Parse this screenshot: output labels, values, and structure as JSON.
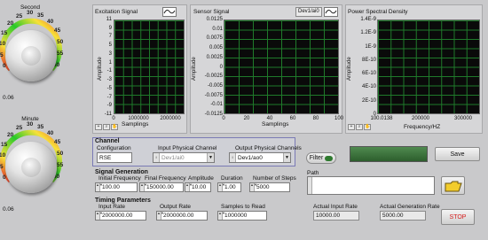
{
  "knobs": {
    "second": {
      "title": "Second",
      "scale": [
        "0",
        "5",
        "10",
        "15",
        "20",
        "25",
        "30",
        "35",
        "40",
        "45",
        "50",
        "55",
        "60"
      ],
      "value_readout": "0.06"
    },
    "minute": {
      "title": "Minute",
      "scale": [
        "0",
        "5",
        "10",
        "15",
        "20",
        "25",
        "30",
        "35",
        "40",
        "45",
        "50",
        "55",
        "60"
      ],
      "value_readout": "0.06"
    }
  },
  "excitation": {
    "title": "Excitation Signal",
    "ylabel": "Amplitude",
    "xlabel": "Samplings",
    "yticks": [
      "11",
      "9",
      "7",
      "5",
      "3",
      "1",
      "-1",
      "-3",
      "-5",
      "-7",
      "-9",
      "-11"
    ],
    "xticks": [
      "0",
      "1000000",
      "2000000"
    ]
  },
  "sensor": {
    "title": "Sensor Signal",
    "channel": "Dev1/ai0",
    "ylabel": "Amplitude",
    "xlabel": "Samplings",
    "yticks": [
      "0.0125",
      "0.01",
      "0.0075",
      "0.005",
      "0.0025",
      "0",
      "-0.0025",
      "-0.005",
      "-0.0075",
      "-0.01",
      "-0.0125"
    ],
    "xticks": [
      "0",
      "20",
      "40",
      "60",
      "80",
      "100"
    ]
  },
  "psd": {
    "title": "Power Spectral Density",
    "ylabel": "Amplitude",
    "xlabel": "Frequency/HZ",
    "yticks": [
      "1.4E-9",
      "1.2E-9",
      "1E-9",
      "8E-10",
      "6E-10",
      "4E-10",
      "2E-10",
      "0"
    ],
    "xticks": [
      "100.0138",
      "200000",
      "300000"
    ]
  },
  "channel": {
    "header": "Channel",
    "config_label": "Configuration",
    "config_value": "RSE",
    "input_label": "Input Physical Channel",
    "input_value": "Dev1/ai0",
    "output_label": "Output Physical Channels",
    "output_value": "Dev1/ao0"
  },
  "filter": {
    "label": "Filter"
  },
  "save": {
    "label": "Save"
  },
  "signal_gen": {
    "header": "Signal Generation",
    "initial_freq_label": "Initial Frequency",
    "initial_freq": "100.00",
    "final_freq_label": "Final Frequency",
    "final_freq": "150000.00",
    "amplitude_label": "Amplitude",
    "amplitude": "10.00",
    "duration_label": "Duration",
    "duration": "1.00",
    "steps_label": "Number of Steps",
    "steps": "5000"
  },
  "path": {
    "label": "Path",
    "value": ""
  },
  "timing": {
    "header": "Timing Parameters",
    "input_rate_label": "Input Rate",
    "input_rate": "2000000.00",
    "output_rate_label": "Output Rate",
    "output_rate": "2000000.00",
    "samples_label": "Samples to Read",
    "samples": "1000000",
    "actual_input_label": "Actual Input Rate",
    "actual_input": "10000.00",
    "actual_gen_label": "Actual  Generation Rate",
    "actual_gen": "5000.00"
  },
  "stop": {
    "label": "STOP"
  },
  "colors": {
    "plot_bg": "#0a0a0a",
    "grid": "#1f7a2a",
    "stop_text": "#d62020",
    "led": "#3a6e3a"
  }
}
